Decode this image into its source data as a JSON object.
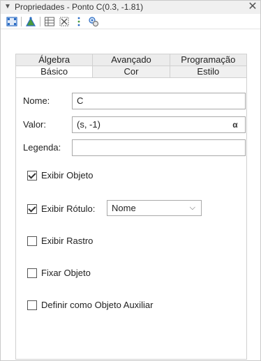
{
  "window": {
    "title": "Propriedades - Ponto C(0.3, -1.81)"
  },
  "toolbar": {
    "icons": [
      "graphics-icon",
      "geometry-icon",
      "spreadsheet-icon",
      "algebra-icon",
      "more-icon",
      "settings-icon"
    ]
  },
  "tabs": {
    "back_row": [
      "Álgebra",
      "Avançado",
      "Programação"
    ],
    "front_row": [
      "Básico",
      "Cor",
      "Estilo"
    ],
    "active": "Básico"
  },
  "form": {
    "name_label": "Nome:",
    "name_value": "C",
    "value_label": "Valor:",
    "value_value": "(s, -1)",
    "alpha_button": "α",
    "caption_label": "Legenda:",
    "caption_value": "",
    "show_object_label": "Exibir Objeto",
    "show_object_checked": true,
    "show_label_label": "Exibir Rótulo:",
    "show_label_checked": true,
    "label_mode": "Nome",
    "show_trace_label": "Exibir Rastro",
    "show_trace_checked": false,
    "fix_object_label": "Fixar Objeto",
    "fix_object_checked": false,
    "auxiliary_label": "Definir como Objeto Auxiliar",
    "auxiliary_checked": false
  },
  "colors": {
    "accent_blue": "#2b6cc4",
    "accent_green": "#4a9a3a",
    "panel_gray": "#f0f0f0"
  }
}
